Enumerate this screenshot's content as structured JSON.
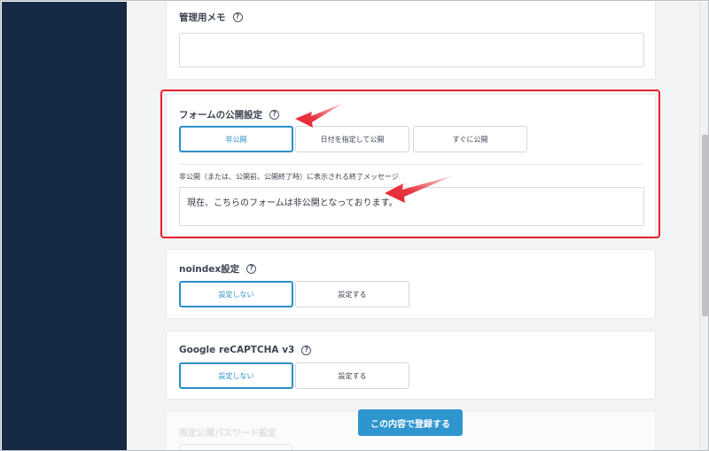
{
  "memo": {
    "label": "管理用メモ",
    "help_glyph": "?",
    "value": ""
  },
  "publish": {
    "label": "フォームの公開設定",
    "help_glyph": "?",
    "options": [
      "非公開",
      "日付を指定して公開",
      "すぐに公開"
    ],
    "selected": "非公開",
    "message_label": "非公開（または、公開前、公開終了時）に表示される終了メッセージ",
    "message_value": "現在、こちらのフォームは非公開となっております。"
  },
  "noindex": {
    "label": "noindex設定",
    "help_glyph": "?",
    "options": [
      "設定しない",
      "設定する"
    ],
    "selected": "設定しない"
  },
  "recaptcha": {
    "label": "Google reCAPTCHA v3",
    "help_glyph": "?",
    "options": [
      "設定しない",
      "設定する"
    ],
    "selected": "設定しない"
  },
  "password": {
    "label": "限定公開パスワード設定"
  },
  "submit_label": "この内容で登録する",
  "colors": {
    "sidebar": "#172a45",
    "accent": "#2d8fc9",
    "highlight": "#e5222e",
    "submit": "#2f95cf"
  },
  "icons": [
    "help-circle-icon",
    "annotation-arrow-icon"
  ]
}
